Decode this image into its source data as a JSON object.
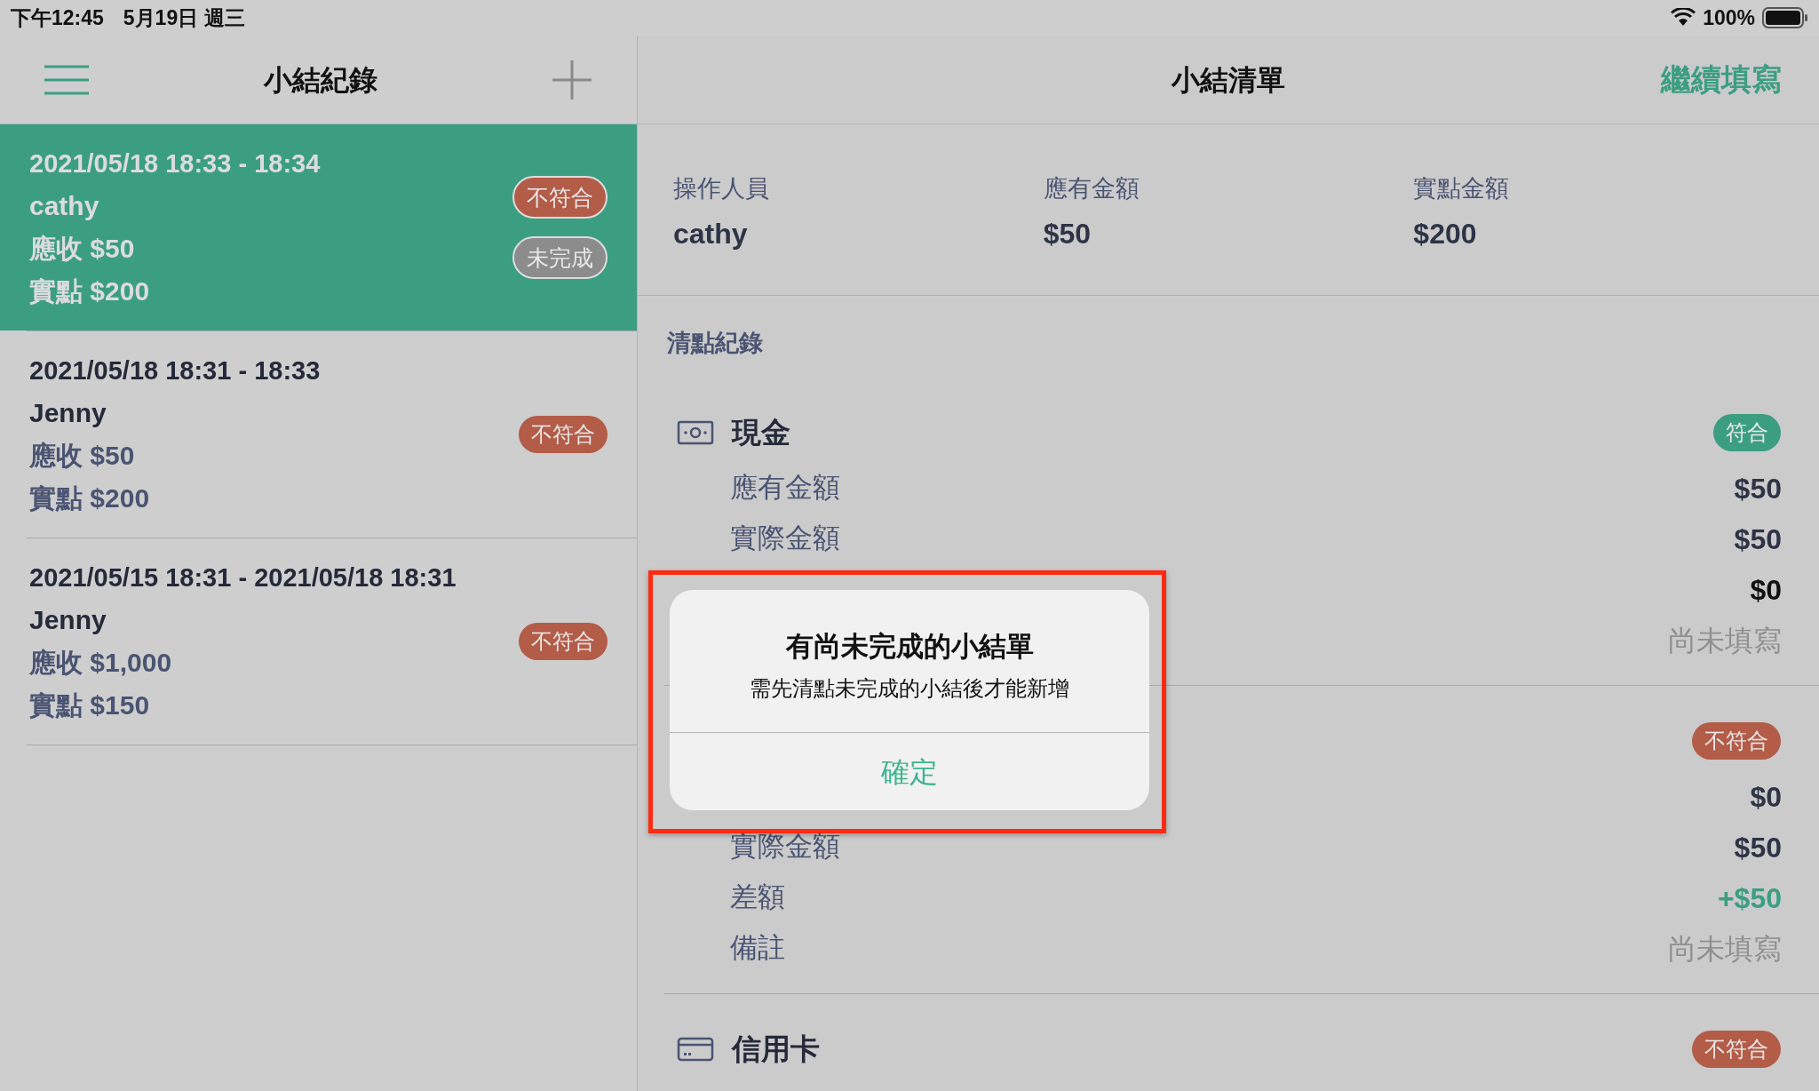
{
  "status_bar": {
    "time": "下午12:45",
    "date": "5月19日 週三",
    "battery": "100%"
  },
  "left_nav": {
    "title": "小結紀錄"
  },
  "records": [
    {
      "period": "2021/05/18 18:33 - 18:34",
      "operator": "cathy",
      "expected": "應收 $50",
      "counted": "實點 $200",
      "selected": true,
      "badges": [
        {
          "label": "不符合",
          "kind": "mismatch"
        },
        {
          "label": "未完成",
          "kind": "incomplete"
        }
      ]
    },
    {
      "period": "2021/05/18 18:31 - 18:33",
      "operator": "Jenny",
      "expected": "應收 $50",
      "counted": "實點 $200",
      "selected": false,
      "badges": [
        {
          "label": "不符合",
          "kind": "mismatch"
        }
      ]
    },
    {
      "period": "2021/05/15 18:31 - 2021/05/18 18:31",
      "operator": "Jenny",
      "expected": "應收 $1,000",
      "counted": "實點 $150",
      "selected": false,
      "badges": [
        {
          "label": "不符合",
          "kind": "mismatch"
        }
      ]
    }
  ],
  "right_nav": {
    "title": "小結清單",
    "action": "繼續填寫"
  },
  "summary": [
    {
      "label": "操作人員",
      "value": "cathy"
    },
    {
      "label": "應有金額",
      "value": "$50"
    },
    {
      "label": "實點金額",
      "value": "$200"
    }
  ],
  "section_title": "清點紀錄",
  "groups": [
    {
      "kind": "cash",
      "title": "現金",
      "badge": {
        "label": "符合",
        "kind": "match"
      },
      "rows": [
        {
          "label": "應有金額",
          "value": "$50",
          "kind": "normal"
        },
        {
          "label": "實際金額",
          "value": "$50",
          "kind": "normal"
        },
        {
          "value": "$0",
          "kind": "strong"
        },
        {
          "value": "尚未填寫",
          "kind": "empty"
        }
      ]
    },
    {
      "badge": {
        "label": "不符合",
        "kind": "mismatch"
      },
      "rows": [
        {
          "value": "$0",
          "kind": "normal"
        },
        {
          "label": "實際金額",
          "value": "$50",
          "kind": "normal"
        },
        {
          "label": "差額",
          "value": "+$50",
          "kind": "positive"
        },
        {
          "label": "備註",
          "value": "尚未填寫",
          "kind": "empty"
        }
      ]
    },
    {
      "kind": "card",
      "title": "信用卡",
      "badge": {
        "label": "不符合",
        "kind": "mismatch"
      }
    }
  ],
  "dialog": {
    "title": "有尚未完成的小結單",
    "message": "需先清點未完成的小結後才能新增",
    "button": "確定"
  }
}
